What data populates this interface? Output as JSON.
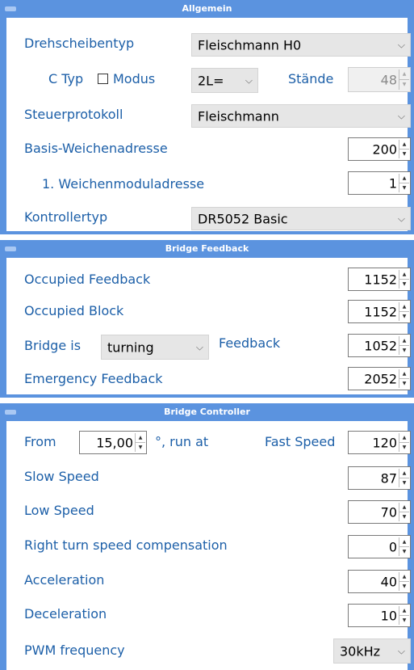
{
  "allgemein": {
    "title": "Allgemein",
    "drehscheibentyp": {
      "label": "Drehscheibentyp",
      "value": "Fleischmann H0"
    },
    "ctyp": {
      "label": "C Typ",
      "modus_label": "Modus",
      "modus_checked": false,
      "mode_value": "2L=",
      "staende_label": "Stände",
      "staende_value": "48"
    },
    "steuerprotokoll": {
      "label": "Steuerprotokoll",
      "value": "Fleischmann"
    },
    "basis": {
      "label": "Basis-Weichenadresse",
      "value": "200"
    },
    "weichenmodul": {
      "label": "1. Weichenmoduladresse",
      "value": "1"
    },
    "kontrollertyp": {
      "label": "Kontrollertyp",
      "value": "DR5052 Basic"
    }
  },
  "bridge_feedback": {
    "title": "Bridge Feedback",
    "occupied_feedback": {
      "label": "Occupied Feedback",
      "value": "1152"
    },
    "occupied_block": {
      "label": "Occupied Block",
      "value": "1152"
    },
    "bridge_is": {
      "label": "Bridge is",
      "select_value": "turning",
      "feedback_label": "Feedback",
      "value": "1052"
    },
    "emergency": {
      "label": "Emergency Feedback",
      "value": "2052"
    }
  },
  "bridge_controller": {
    "title": "Bridge Controller",
    "from": {
      "label": "From",
      "value": "15,00",
      "unit_label": "°, run at",
      "fast_label": "Fast Speed",
      "fast_value": "120"
    },
    "slow_speed": {
      "label": "Slow Speed",
      "value": "87"
    },
    "low_speed": {
      "label": "Low Speed",
      "value": "70"
    },
    "right_turn": {
      "label": "Right turn speed compensation",
      "value": "0"
    },
    "acceleration": {
      "label": "Acceleration",
      "value": "40"
    },
    "deceleration": {
      "label": "Deceleration",
      "value": "10"
    },
    "pwm": {
      "label": "PWM frequency",
      "value": "30kHz"
    }
  }
}
